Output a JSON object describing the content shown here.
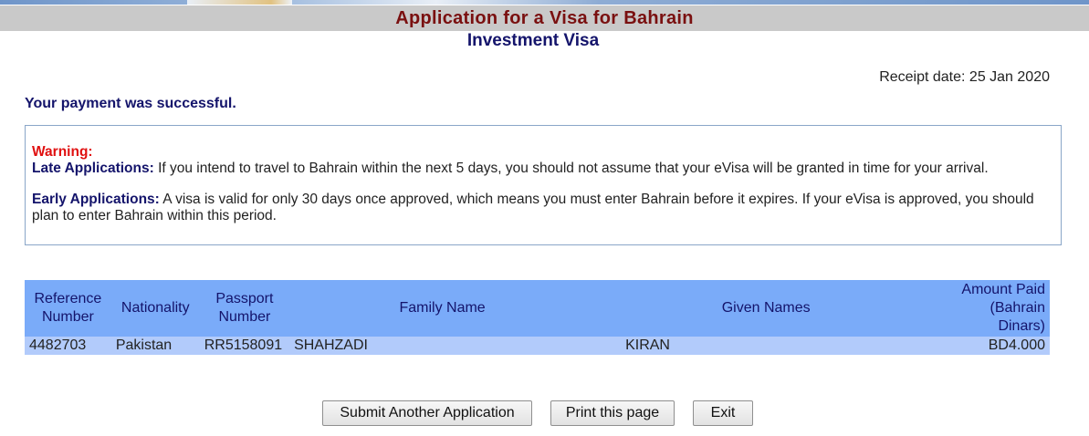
{
  "header": {
    "title": "Application for a Visa for Bahrain",
    "subtitle": "Investment Visa"
  },
  "receipt": {
    "label": "Receipt date: 25 Jan 2020"
  },
  "payment_message": "Your payment was successful.",
  "warning": {
    "title": "Warning:",
    "late_label": "Late Applications:",
    "late_text": " If you intend to travel to Bahrain within the next 5 days, you should not assume that your eVisa will be granted in time for your arrival.",
    "early_label": "Early Applications:",
    "early_text": " A visa is valid for only 30 days once approved, which means you must enter Bahrain before it expires. If your eVisa is approved, you should plan to enter Bahrain within this period."
  },
  "table": {
    "columns": {
      "reference": [
        "Reference",
        "Number"
      ],
      "nationality": "Nationality",
      "passport": [
        "Passport",
        "Number"
      ],
      "family_name": "Family Name",
      "given_names": "Given Names",
      "amount": [
        "Amount Paid",
        "(Bahrain Dinars)"
      ]
    },
    "rows": [
      {
        "reference": "4482703",
        "nationality": "Pakistan",
        "passport": "RR5158091",
        "family_name": "SHAHZADI",
        "given_names": "KIRAN",
        "amount": "BD4.000"
      }
    ]
  },
  "buttons": {
    "submit_another": "Submit Another Application",
    "print": "Print this page",
    "exit": "Exit"
  },
  "colors": {
    "title": "#7a1010",
    "navy": "#14146b",
    "warning_red": "#e01010",
    "table_header": "#7aabf9",
    "table_row": "#b2cbfb"
  }
}
